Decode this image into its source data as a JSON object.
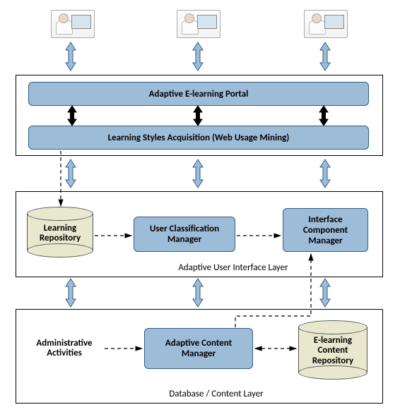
{
  "layers": {
    "presentation": {
      "portal": "Adaptive E-learning Portal",
      "acquisition": "Learning Styles Acquisition (Web Usage Mining)"
    },
    "ui_layer": {
      "label": "Adaptive User Interface Layer",
      "learning_repo": "Learning Repository",
      "user_class_mgr": "User Classification Manager",
      "interface_mgr": "Interface Component Manager"
    },
    "content_layer": {
      "label": "Database / Content Layer",
      "admin": "Administrative Activities",
      "content_mgr": "Adaptive Content Manager",
      "content_repo": "E-learning Content Repository"
    }
  },
  "actors": {
    "user": "user-at-computer"
  }
}
